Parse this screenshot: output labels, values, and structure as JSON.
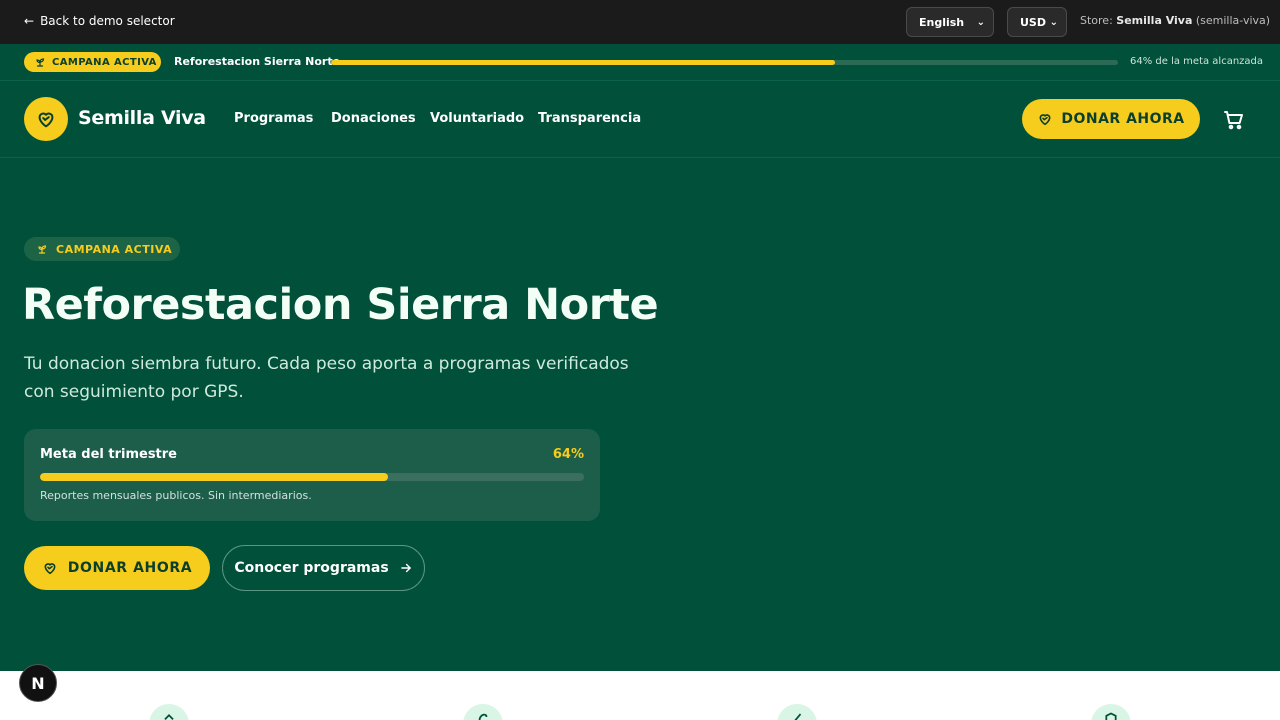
{
  "demo_bar": {
    "back_label": "Back to demo selector",
    "language": "English",
    "currency": "USD",
    "store_prefix": "Store:",
    "store_name": "Semilla Viva",
    "store_slug": "(semilla-viva)"
  },
  "campaign_strip": {
    "badge": "CAMPANA ACTIVA",
    "title": "Reforestacion Sierra Norte",
    "progress_pct": 64,
    "progress_text": "64% de la meta alcanzada"
  },
  "nav": {
    "brand": "Semilla Viva",
    "links": [
      "Programas",
      "Donaciones",
      "Voluntariado",
      "Transparencia"
    ],
    "donate": "DONAR AHORA"
  },
  "hero": {
    "badge": "CAMPANA ACTIVA",
    "title": "Reforestacion Sierra Norte",
    "subtitle": "Tu donacion siembra futuro. Cada peso aporta a programas verificados con seguimiento por GPS.",
    "goal": {
      "label": "Meta del trimestre",
      "pct_text": "64%",
      "pct": 64,
      "note": "Reportes mensuales publicos. Sin intermediarios."
    },
    "donate": "DONAR AHORA",
    "programs": "Conocer programas"
  },
  "colors": {
    "primary_green": "#00503a",
    "accent_yellow": "#f6cd1c",
    "dark_bar": "#1b1b1b"
  },
  "icons": [
    "arrow-left-icon",
    "chevron-down-icon",
    "sprout-icon",
    "heart-handshake-icon",
    "cart-icon",
    "arrow-right-icon"
  ]
}
